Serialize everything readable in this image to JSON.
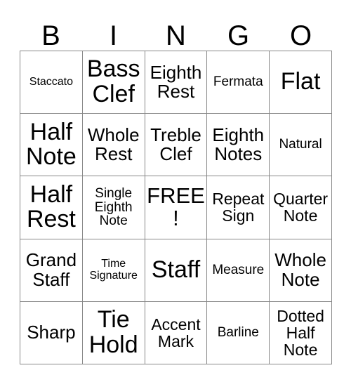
{
  "card": {
    "header_letters": [
      "B",
      "I",
      "N",
      "G",
      "O"
    ],
    "rows": [
      [
        {
          "label": "Staccato",
          "size": "fs-xs"
        },
        {
          "label": "Bass Clef",
          "size": "fs-xxl"
        },
        {
          "label": "Eighth Rest",
          "size": "fs-l"
        },
        {
          "label": "Fermata",
          "size": "fs-s"
        },
        {
          "label": "Flat",
          "size": "fs-xxl"
        }
      ],
      [
        {
          "label": "Half Note",
          "size": "fs-xxl"
        },
        {
          "label": "Whole Rest",
          "size": "fs-l"
        },
        {
          "label": "Treble Clef",
          "size": "fs-l"
        },
        {
          "label": "Eighth Notes",
          "size": "fs-l"
        },
        {
          "label": "Natural",
          "size": "fs-s"
        }
      ],
      [
        {
          "label": "Half Rest",
          "size": "fs-xxl"
        },
        {
          "label": "Single Eighth Note",
          "size": "fs-s"
        },
        {
          "label": "FREE!",
          "size": "fs-xl"
        },
        {
          "label": "Repeat Sign",
          "size": "fs-m"
        },
        {
          "label": "Quarter Note",
          "size": "fs-m"
        }
      ],
      [
        {
          "label": "Grand Staff",
          "size": "fs-l"
        },
        {
          "label": "Time Signature",
          "size": "fs-xs"
        },
        {
          "label": "Staff",
          "size": "fs-xxl"
        },
        {
          "label": "Measure",
          "size": "fs-s"
        },
        {
          "label": "Whole Note",
          "size": "fs-l"
        }
      ],
      [
        {
          "label": "Sharp",
          "size": "fs-l"
        },
        {
          "label": "Tie Hold",
          "size": "fs-xxl"
        },
        {
          "label": "Accent Mark",
          "size": "fs-m"
        },
        {
          "label": "Barline",
          "size": "fs-s"
        },
        {
          "label": "Dotted Half Note",
          "size": "fs-m"
        }
      ]
    ]
  },
  "colors": {
    "background": "#ffffff",
    "text": "#000000",
    "border": "#888888"
  }
}
